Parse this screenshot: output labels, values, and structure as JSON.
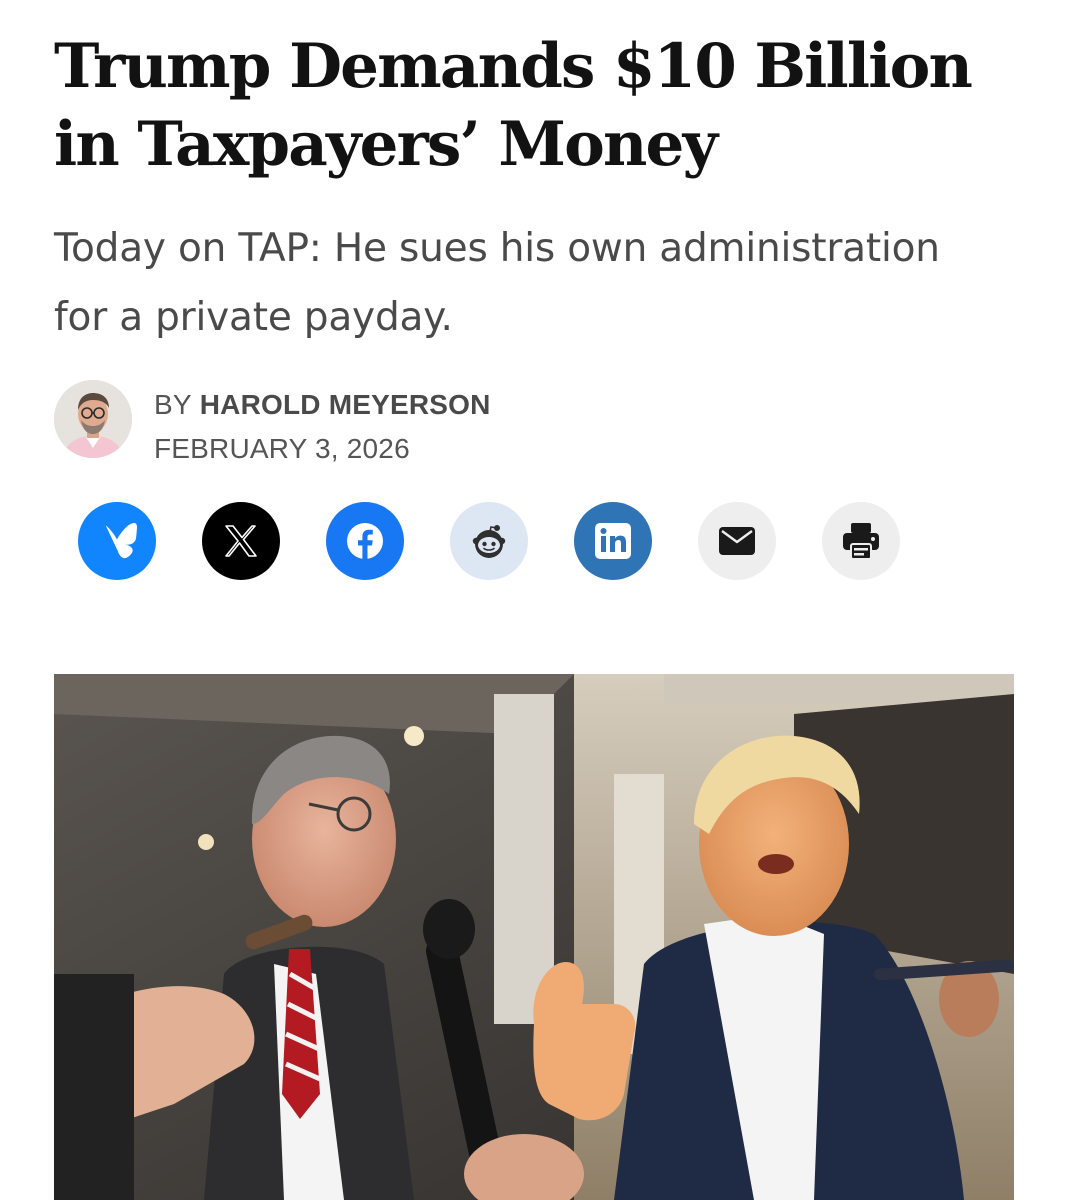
{
  "article": {
    "headline_line1": "Trump Demands $10 Billion",
    "headline_line2": "in Taxpayers’ Money",
    "dek_line1": "Today on TAP: He sues his own administration",
    "dek_line2": "for a private payday.",
    "byline_prefix": "BY",
    "author": "HAROLD MEYERSON",
    "date": "FEBRUARY 3, 2026"
  },
  "share_buttons": [
    {
      "name": "bluesky",
      "icon": "butterfly-icon",
      "bg": "#1185fe"
    },
    {
      "name": "x",
      "icon": "x-logo-icon",
      "bg": "#000000"
    },
    {
      "name": "facebook",
      "icon": "facebook-icon",
      "bg": "#1877f2"
    },
    {
      "name": "reddit",
      "icon": "reddit-icon",
      "bg": "#dde6f3"
    },
    {
      "name": "linkedin",
      "icon": "linkedin-icon",
      "bg": "#2f75b5"
    },
    {
      "name": "email",
      "icon": "mail-icon",
      "bg": "#eeeeee"
    },
    {
      "name": "print",
      "icon": "printer-icon",
      "bg": "#eeeeee"
    }
  ],
  "colors": {
    "headline": "#121212",
    "dek": "#4a4a4a",
    "meta": "#555555"
  }
}
